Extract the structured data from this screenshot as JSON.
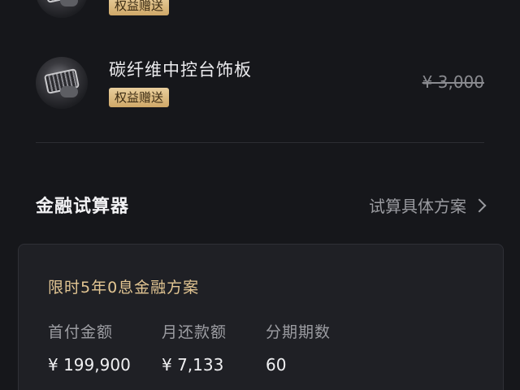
{
  "items": [
    {
      "name": "",
      "badge": "权益赠送",
      "price": ""
    },
    {
      "name": "碳纤维中控台饰板",
      "badge": "权益赠送",
      "price": "¥ 3,000"
    }
  ],
  "finance": {
    "title": "金融试算器",
    "link_label": "试算具体方案",
    "plan_title": "限时5年0息金融方案",
    "columns": [
      {
        "label": "首付金额",
        "value": "¥ 199,900"
      },
      {
        "label": "月还款额",
        "value": "¥ 7,133"
      },
      {
        "label": "分期期数",
        "value": "60"
      }
    ]
  },
  "colors": {
    "background": "#16171b",
    "badge_gold": "#cfa868",
    "plan_title_gold": "#e3c693"
  }
}
